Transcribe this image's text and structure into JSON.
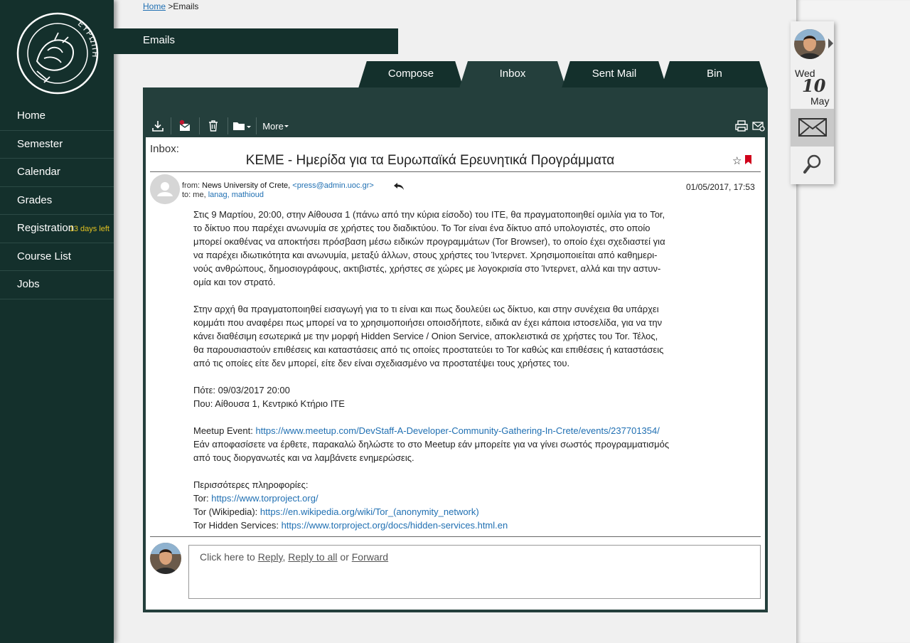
{
  "nav": {
    "items": [
      {
        "label": "Home"
      },
      {
        "label": "Semester"
      },
      {
        "label": "Calendar"
      },
      {
        "label": "Grades"
      },
      {
        "label": "Registration",
        "badge": "13 days left"
      },
      {
        "label": "Course List"
      },
      {
        "label": "Jobs"
      }
    ],
    "logo_text": "ΕΥΡΩΠΗ"
  },
  "breadcrumb": {
    "home": "Home",
    "separator": ">",
    "current": "Emails"
  },
  "header": {
    "title": "Emails"
  },
  "tabs": [
    {
      "label": "Compose",
      "active": false
    },
    {
      "label": "Inbox",
      "active": true
    },
    {
      "label": "Sent Mail",
      "active": false
    },
    {
      "label": "Bin",
      "active": false
    }
  ],
  "toolbar": {
    "more_label": "More"
  },
  "email": {
    "folder_label": "Inbox:",
    "subject": "ΚΕΜΕ - Ημερίδα για τα Ευρωπαϊκά Ερευνητικά Προγράμματα",
    "from_prefix": "from:",
    "from_name": "News University of Crete,",
    "from_email": "<press@admin.uoc.gr>",
    "to_prefix": "to: me,",
    "to_recipients": "lanag, mathioud",
    "date": "01/05/2017, 17:53",
    "body": {
      "p1_lines": [
        "Στις 9 Μαρτίου, 20:00, στην Αίθουσα 1 (πάνω από την κύρια είσοδο) του ΙΤΕ, θα πραγματοποιηθεί ομιλία για το Tor,",
        "το δίκτυο που παρέχει ανωνυμία σε χρήστες του διαδικτύου. Το Tor είναι ένα δίκτυο από υπολογιστές, στο οποίο",
        "μπορεί οκαθένας να αποκτήσει πρόσβαση μέσω ειδικών προγραμμάτων (Tor Browser), το οποίο έχει σχεδιαστεί για",
        "να παρέχει ιδιωτικότητα και ανωνυμία, μεταξύ άλλων, στους χρήστες του Ίντερνετ. Χρησιμοποιείται από καθημερι-",
        "νούς ανθρώπους, δημοσιογράφους, ακτιβιστές, χρήστες σε χώρες με λογοκρισία στο Ίντερνετ, αλλά και την αστυν-",
        "ομία και τον στρατό."
      ],
      "p2_lines": [
        "Στην αρχή θα πραγματοποιηθεί εισαγωγή για το τι είναι και πως δουλεύει ως δίκτυο, και στην συνέχεια θα υπάρχει",
        "κομμάτι που αναφέρει πως μπορεί να το χρησιμοποιήσει οποισδήποτε, ειδικά αν έχει κάποια ιστοσελίδα, για να την",
        "κάνει διαθέσιμη εσωτερικά με την μορφή Hidden Service / Onion Service, αποκλειστικά σε χρήστες του Tor. Τέλος,",
        "θα παρουσιαστούν επιθέσεις και καταστάσεις από τις οποίες προστατεύει το Tor καθώς και επιθέσεις ή καταστάσεις",
        "από τις οποίες είτε δεν μπορεί, είτε δεν είναι σχεδιασμένο να προστατέψει τους χρήστες του."
      ],
      "when": "Πότε: 09/03/2017 20:00",
      "where": "Που: Αίθουσα 1, Κεντρικό Κτήριο ΙΤΕ",
      "meetup_label": "Meetup Event:",
      "meetup_url": "https://www.meetup.com/DevStaff-A-Developer-Community-Gathering-In-Crete/events/237701354/",
      "rsvp_lines": [
        "Εάν αποφασίσετε να έρθετε, παρακαλώ δηλώστε το στο Meetup εάν μπορείτε για να γίνει σωστός προγραμματισμός",
        "από τους διοργανωτές και να λαμβάνετε ενημερώσεις."
      ],
      "more_info": "Περισσότερες πληροφορίες:",
      "links": [
        {
          "label": "Tor:",
          "url": "https://www.torproject.org/"
        },
        {
          "label": "Tor (Wikipedia):",
          "url": "https://en.wikipedia.org/wiki/Tor_(anonymity_network)"
        },
        {
          "label": "Tor Hidden Services:",
          "url": "https://www.torproject.org/docs/hidden-services.html.en"
        }
      ]
    }
  },
  "reply": {
    "prefix": "Click here to",
    "reply": "Reply",
    "comma": ",",
    "reply_all": "Reply to all",
    "or": "or",
    "forward": "Forward"
  },
  "widget": {
    "day": "Wed",
    "date": "10",
    "month": "May"
  },
  "colors": {
    "sidebar": "#14302c",
    "panel": "#243f3c",
    "link": "#1f6fb2",
    "badge": "#e0c020",
    "flag": "#d0021b"
  }
}
